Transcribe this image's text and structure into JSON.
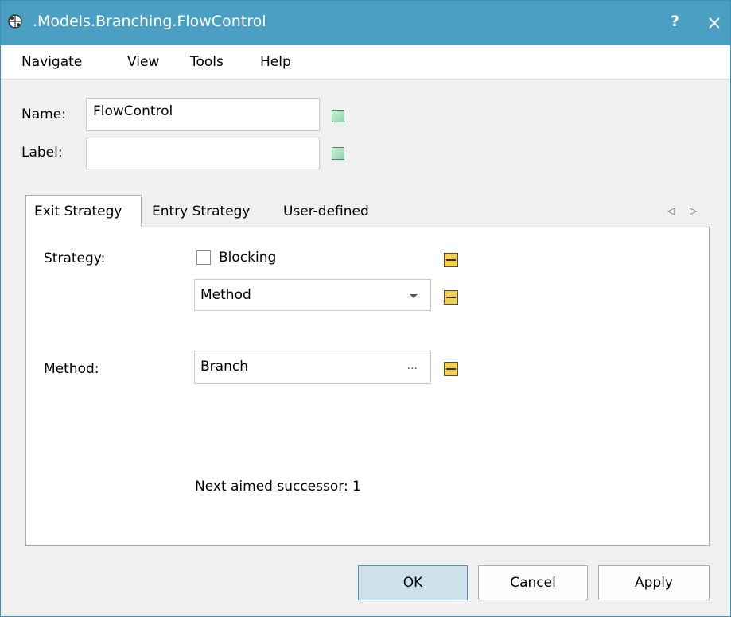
{
  "window": {
    "title": ".Models.Branching.FlowControl",
    "help_label": "?"
  },
  "menu": [
    "Navigate",
    "View",
    "Tools",
    "Help"
  ],
  "fields": {
    "name_label": "Name:",
    "name_value": "FlowControl",
    "label_label": "Label:",
    "label_value": ""
  },
  "tabs": [
    "Exit Strategy",
    "Entry Strategy",
    "User-defined"
  ],
  "active_tab": "Exit Strategy",
  "exit_strategy": {
    "strategy_label": "Strategy:",
    "blocking_label": "Blocking",
    "blocking_checked": false,
    "strategy_value": "Method",
    "method_label": "Method:",
    "method_value": "Branch",
    "method_button": "...",
    "next_successor": "Next aimed successor: 1"
  },
  "buttons": {
    "ok": "OK",
    "cancel": "Cancel",
    "apply": "Apply"
  },
  "colors": {
    "titlebar": "#4a9fc3",
    "indicator_green": "#8fd3a9",
    "indicator_yellow": "#f3cf52"
  },
  "icons": [
    "app-icon",
    "help-icon",
    "close-icon",
    "scroll-left-icon",
    "scroll-right-icon",
    "dropdown-caret-icon"
  ]
}
